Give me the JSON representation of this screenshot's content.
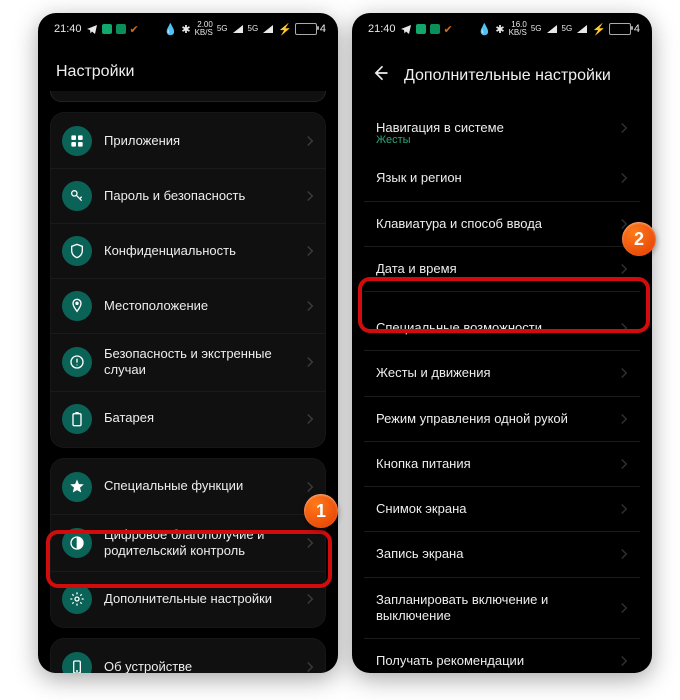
{
  "status": {
    "time": "21:40",
    "net_caption_top": "2.00",
    "net_caption_bottom": "KB/S",
    "net_caption_top_r": "16.0",
    "signal_gen_left": "5G",
    "signal_gen_right": "5G",
    "battery_text": "4"
  },
  "left": {
    "title": "Настройки",
    "group1": [
      {
        "icon": "apps",
        "label": "Приложения"
      },
      {
        "icon": "key",
        "label": "Пароль и безопасность"
      },
      {
        "icon": "shield",
        "label": "Конфиденциальность"
      },
      {
        "icon": "pin",
        "label": "Местоположение"
      },
      {
        "icon": "emergency",
        "label": "Безопасность и экстренные случаи"
      },
      {
        "icon": "battery",
        "label": "Батарея"
      }
    ],
    "group2": [
      {
        "icon": "star",
        "label": "Специальные функции"
      },
      {
        "icon": "wellbeing",
        "label": "Цифровое благополучие и родительский контроль"
      },
      {
        "icon": "gear",
        "label": "Дополнительные настройки"
      }
    ],
    "group3": [
      {
        "icon": "phone",
        "label": "Об устройстве"
      }
    ],
    "badge": "1"
  },
  "right": {
    "title": "Дополнительные настройки",
    "nav_label": "Навигация в системе",
    "nav_sub": "Жесты",
    "group1": [
      "Язык и регион",
      "Клавиатура и способ ввода",
      "Дата и время"
    ],
    "group2": [
      "Специальные возможности",
      "Жесты и движения",
      "Режим управления одной рукой",
      "Кнопка питания",
      "Снимок экрана",
      "Запись экрана",
      "Запланировать включение и выключение",
      "Получать рекомендации"
    ],
    "badge": "2"
  }
}
